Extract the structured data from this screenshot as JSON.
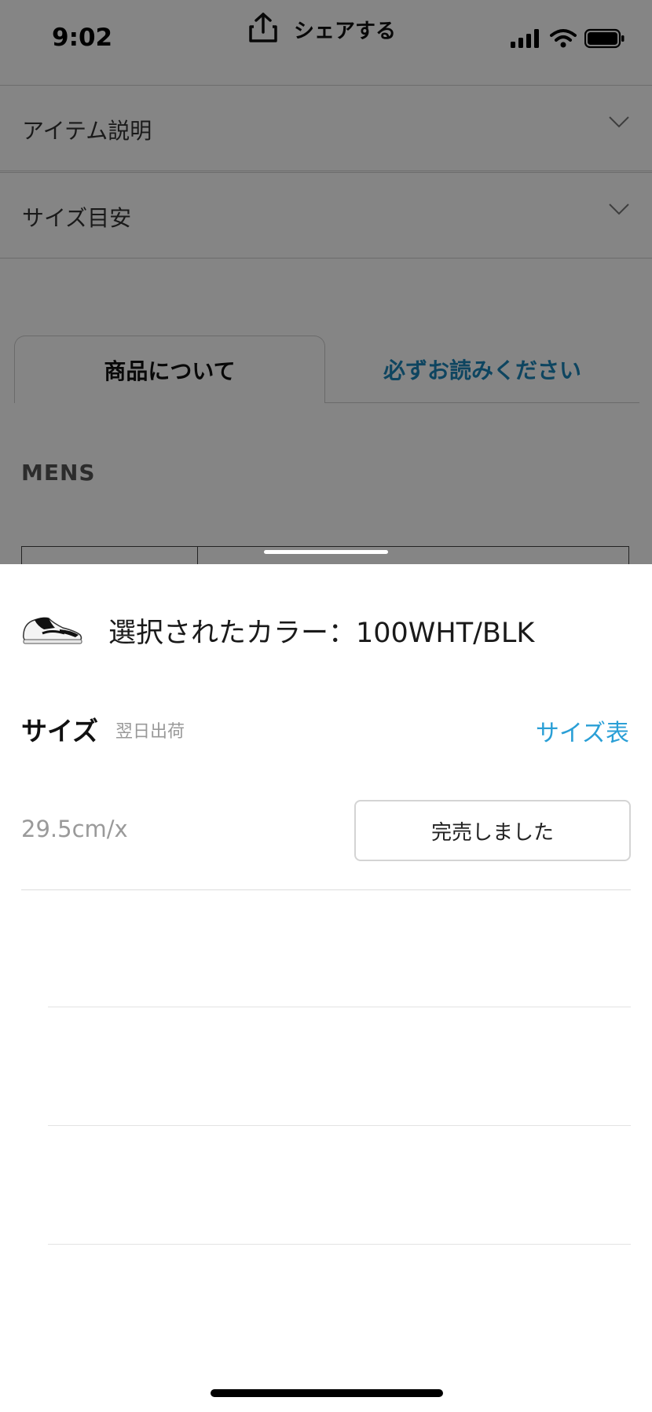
{
  "status_bar": {
    "time": "9:02",
    "share_label": "シェアする",
    "icons": [
      "signal-icon",
      "wifi-icon",
      "battery-icon"
    ]
  },
  "accordions": [
    {
      "label": "アイテム説明",
      "icon": "chevron-down-icon"
    },
    {
      "label": "サイズ目安",
      "icon": "chevron-down-icon"
    }
  ],
  "tabs": {
    "active": "商品について",
    "inactive": "必ずお読みください"
  },
  "section_title": "MENS",
  "sheet": {
    "selected_color": "選択されたカラー：100WHT/BLK",
    "size_title": "サイズ",
    "ship_note": "翌日出荷",
    "size_chart_link": "サイズ表",
    "sizes": [
      {
        "size": "29.5cm/x",
        "status": "完売しました"
      }
    ]
  },
  "colors": {
    "link_blue": "#2a9fd6",
    "tab_blue": "#1b84b8",
    "overlay": "rgba(0,0,0,0.48)"
  }
}
